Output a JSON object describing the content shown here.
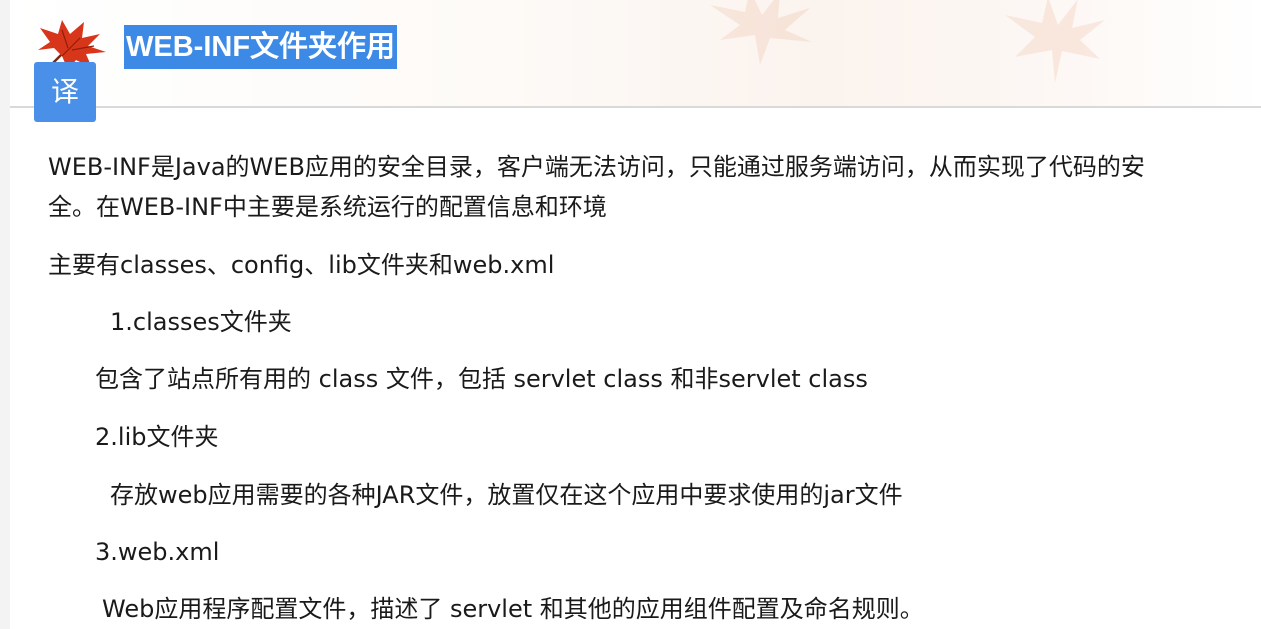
{
  "header": {
    "title": "WEB-INF文件夹作用",
    "translate_label": "译"
  },
  "content": {
    "p1_line1": "WEB-INF是Java的WEB应用的安全目录，客户端无法访问，只能通过服务端访问，从而实现了代码的安",
    "p1_line2": "全。在WEB-INF中主要是系统运行的配置信息和环境",
    "p2": "主要有classes、config、lib文件夹和web.xml",
    "h1": "1.classes文件夹",
    "p3": "包含了站点所有用的 class 文件，包括 servlet class 和非servlet class",
    "h2": "2.lib文件夹",
    "p4": "存放web应用需要的各种JAR文件，放置仅在这个应用中要求使用的jar文件",
    "h3": "3.web.xml",
    "p5": "Web应用程序配置文件，描述了 servlet 和其他的应用组件配置及命名规则。"
  },
  "icons": {
    "logo": "maple-leaf-icon",
    "translate": "translate-button"
  },
  "colors": {
    "title_highlight": "#3d8ae6",
    "translate_button": "#4a90e8",
    "leaf": "#d8361b"
  }
}
